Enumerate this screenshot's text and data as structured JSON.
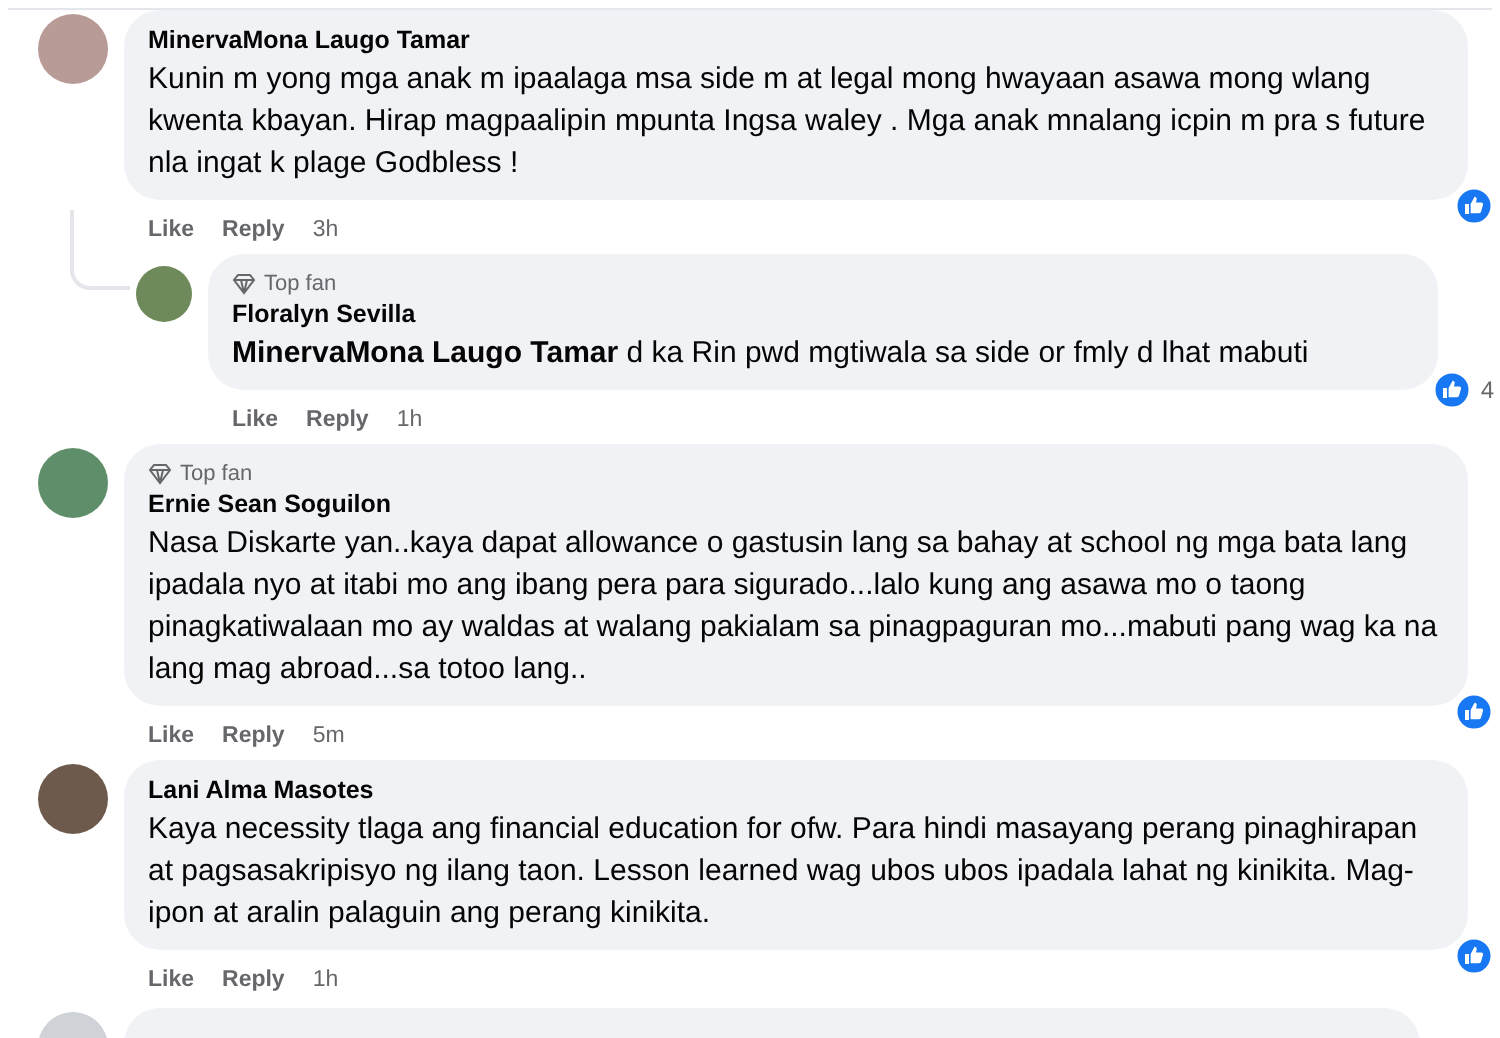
{
  "comments": [
    {
      "kind": "comment",
      "author": "MinervaMona Laugo Tamar",
      "text": "Kunin m yong mga anak m ipaalaga msa side m at legal mong hwayaan asawa mong wlang kwenta kbayan. Hirap magpaalipin mpunta Ingsa waley . Mga anak mnalang icpin m pra s future nla ingat k plage Godbless !",
      "actions": [
        "Like",
        "Reply"
      ],
      "time": "3h"
    },
    {
      "kind": "reply",
      "badge": "Top fan",
      "author": "Floralyn Sevilla",
      "text": "**MinervaMona Laugo Tamar** d ka Rin pwd mgtiwala sa side or fmly d lhat mabuti",
      "actions": [
        "Like",
        "Reply"
      ],
      "time": "1h",
      "reaction_count": "4"
    },
    {
      "kind": "comment",
      "badge": "Top fan",
      "author": "Ernie Sean Soguilon",
      "text": "Nasa Diskarte yan..kaya dapat allowance o gastusin lang sa bahay at school ng mga bata lang ipadala nyo at itabi mo ang ibang pera para sigurado...lalo kung ang asawa mo o taong pinagkatiwalaan mo ay waldas at walang pakialam sa pinagpaguran mo...mabuti pang wag ka na lang mag abroad...sa totoo lang..",
      "actions": [
        "Like",
        "Reply"
      ],
      "time": "5m"
    },
    {
      "kind": "comment",
      "author": "Lani Alma Masotes",
      "text": "Kaya necessity tlaga ang financial education for ofw. Para hindi masayang perang pinaghirapan at pagsasakripisyo ng ilang taon. Lesson learned wag ubos ubos ipadala lahat ng kinikita. Mag-ipon at aralin palaguin ang perang kinikita.",
      "actions": [
        "Like",
        "Reply"
      ],
      "time": "1h"
    }
  ]
}
